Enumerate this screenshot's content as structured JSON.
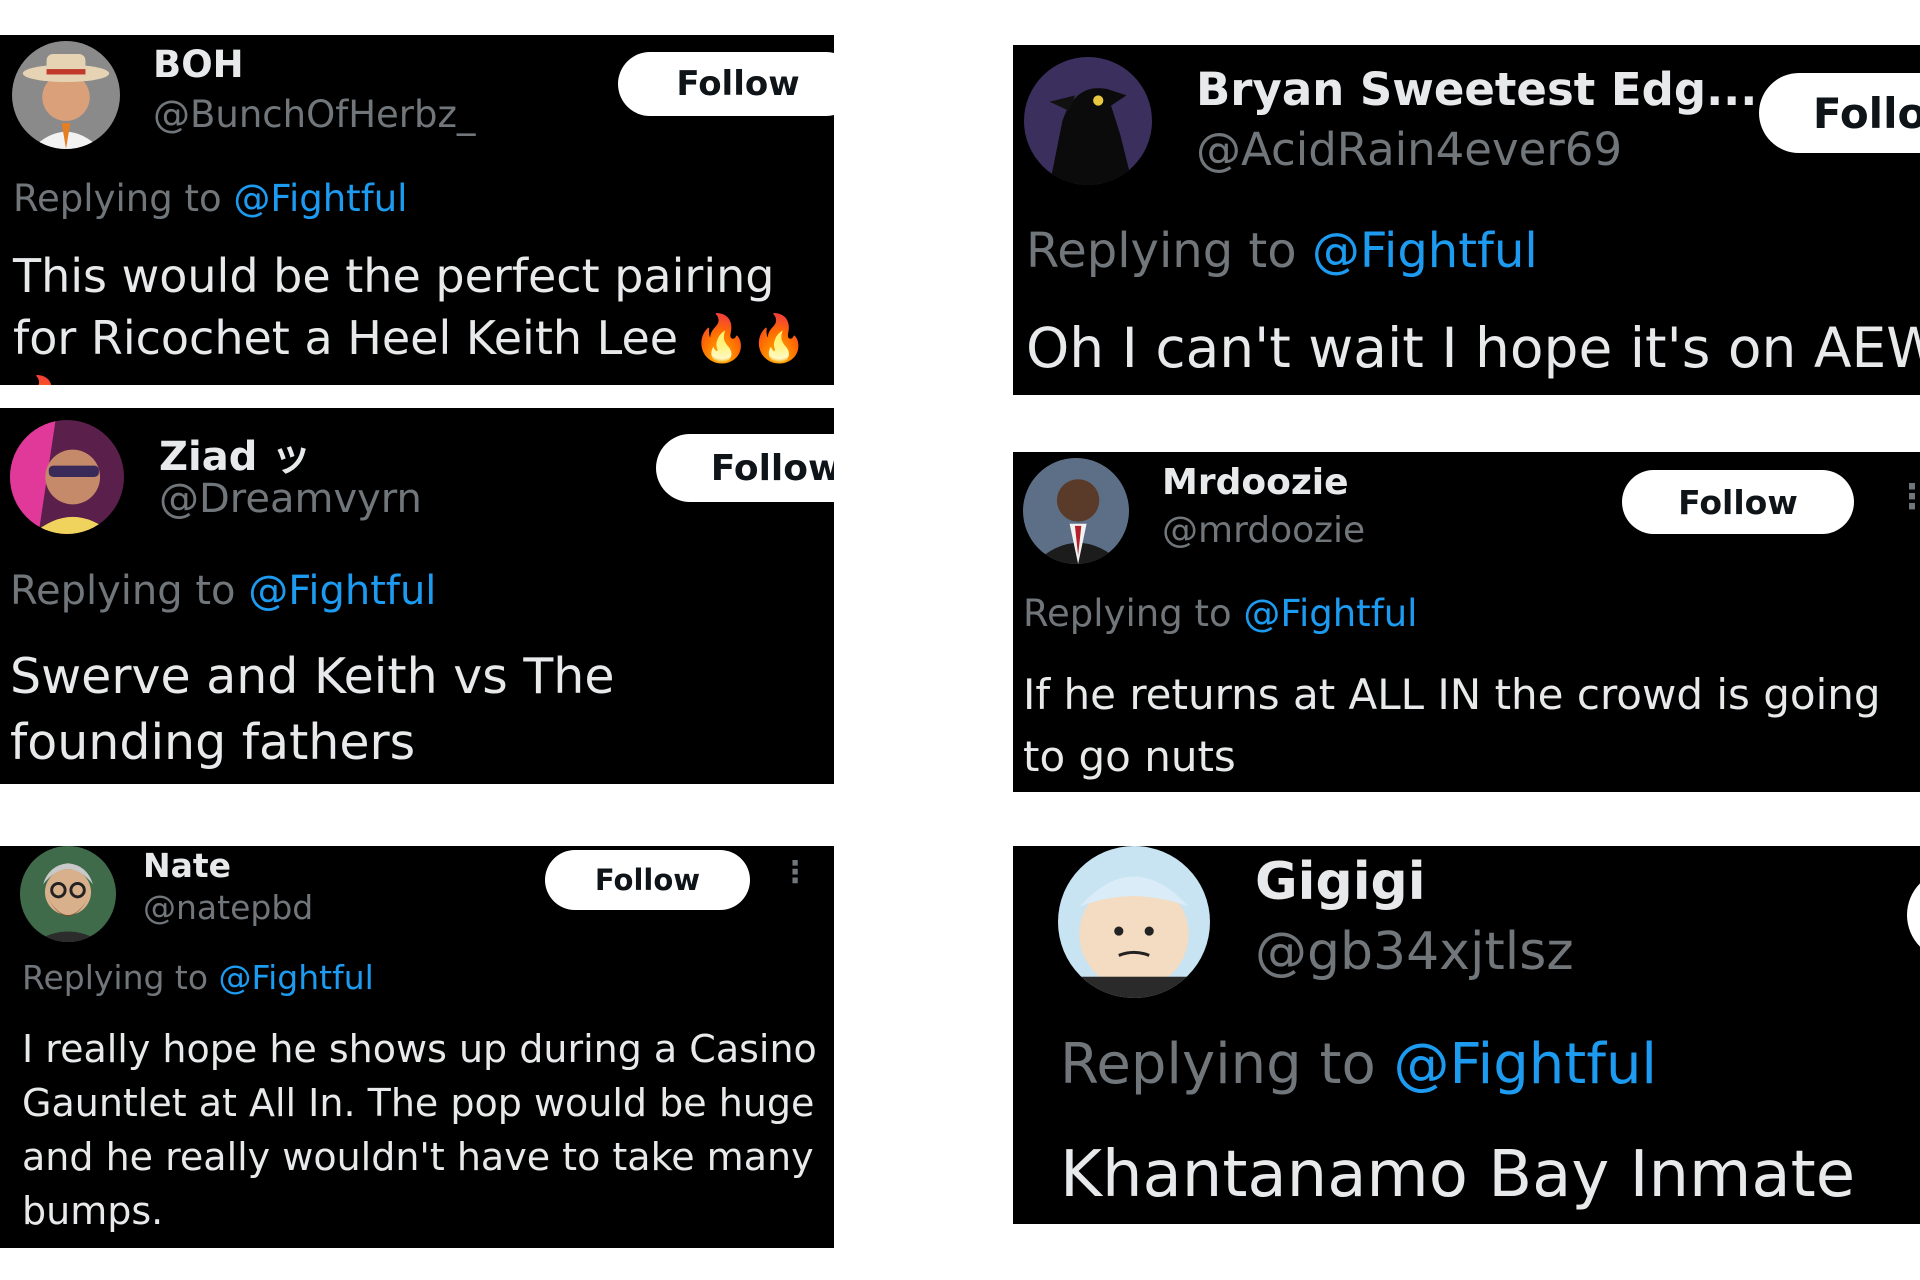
{
  "replying_prefix": "Replying to",
  "follow_label": "Follow",
  "colors": {
    "card_bg": "#000000",
    "text": "#e7e9ea",
    "muted": "#71767b",
    "link": "#1d9bf0",
    "button_bg": "#ffffff"
  },
  "replies": [
    {
      "display_name": "BOH",
      "handle": "@BunchOfHerbz_",
      "mention": "@Fightful",
      "text": "This would be the perfect pairing for Ricochet a Heel Keith Lee",
      "emoji": "🔥🔥🔥",
      "avatar_icon": "man-in-hat-avatar"
    },
    {
      "display_name": "Ziad ッ",
      "handle": "@Dreamvyrn",
      "mention": "@Fightful",
      "text": "Swerve and Keith vs The founding fathers",
      "emoji": "",
      "avatar_icon": "person-pink-sunglasses-avatar"
    },
    {
      "display_name": "Nate",
      "handle": "@natepbd",
      "mention": "@Fightful",
      "text": "I really hope he shows up during a Casino Gauntlet at All In. The pop would be huge and he really wouldn't have to take many bumps.",
      "emoji": "",
      "avatar_icon": "bearded-man-glasses-avatar"
    },
    {
      "display_name": "Bryan Sweetest Edg...",
      "handle": "@AcidRain4ever69",
      "mention": "@Fightful",
      "text": "Oh I can't wait I hope it's on AEW",
      "emoji": "",
      "avatar_icon": "black-bird-avatar"
    },
    {
      "display_name": "Mrdoozie",
      "handle": "@mrdoozie",
      "mention": "@Fightful",
      "text": "If he returns at ALL IN the crowd is going to go nuts",
      "emoji": "",
      "avatar_icon": "man-in-suit-avatar"
    },
    {
      "display_name": "Gigigi",
      "handle": "@gb34xjtlsz",
      "mention": "@Fightful",
      "text": "Khantanamo Bay Inmate",
      "emoji": "",
      "avatar_icon": "cartoon-face-avatar"
    }
  ]
}
